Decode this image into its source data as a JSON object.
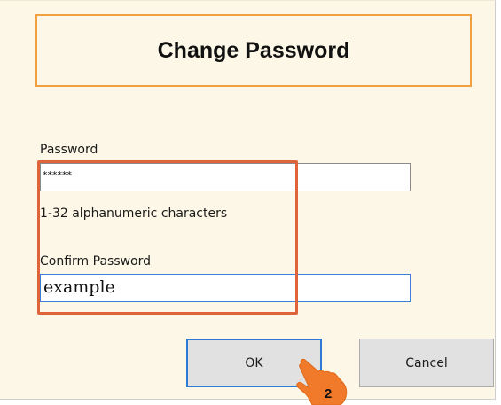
{
  "dialog": {
    "title": "Change Password",
    "password": {
      "label": "Password",
      "value": "******",
      "hint": "1-32 alphanumeric characters"
    },
    "confirm": {
      "label": "Confirm Password",
      "value": "example"
    },
    "buttons": {
      "ok_label": "OK",
      "cancel_label": "Cancel"
    }
  },
  "annotations": {
    "step_number": "2",
    "highlight_color": "#e0643a",
    "cursor_color": "#f07a2a",
    "title_border_color": "#f0a040",
    "focus_color": "#2d7ad6"
  }
}
